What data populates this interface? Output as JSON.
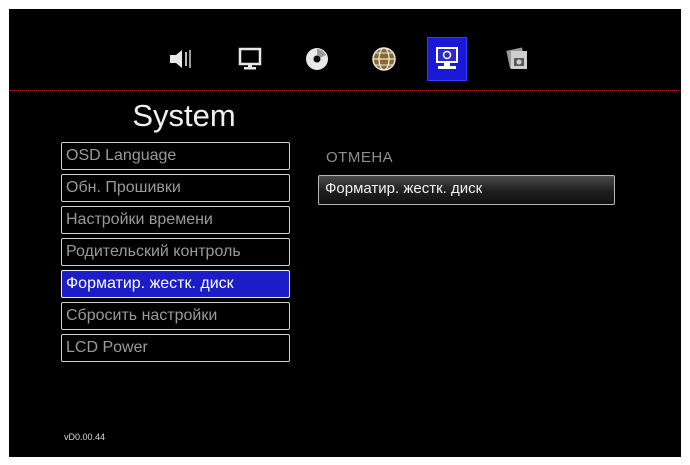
{
  "header": {
    "tabs": [
      {
        "icon": "speaker-icon",
        "active": false
      },
      {
        "icon": "monitor-icon",
        "active": false
      },
      {
        "icon": "disc-icon",
        "active": false
      },
      {
        "icon": "globe-icon",
        "active": false
      },
      {
        "icon": "system-settings-icon",
        "active": true
      },
      {
        "icon": "media-folder-icon",
        "active": false
      }
    ]
  },
  "page": {
    "title": "System"
  },
  "menu": {
    "items": [
      {
        "label": "OSD Language"
      },
      {
        "label": "Обн. Прошивки"
      },
      {
        "label": "Настройки времени"
      },
      {
        "label": "Родительский контроль"
      },
      {
        "label": "Форматир. жестк. диск",
        "selected": true
      },
      {
        "label": "Сбросить настройки"
      },
      {
        "label": "LCD Power"
      }
    ]
  },
  "submenu": {
    "title": "ОТМЕНА",
    "option": "Форматир. жестк. диск"
  },
  "footer": {
    "version": "vD0.00.44"
  },
  "colors": {
    "highlight": "#1c1cc8",
    "background": "#000000",
    "divider": "#b02020"
  }
}
